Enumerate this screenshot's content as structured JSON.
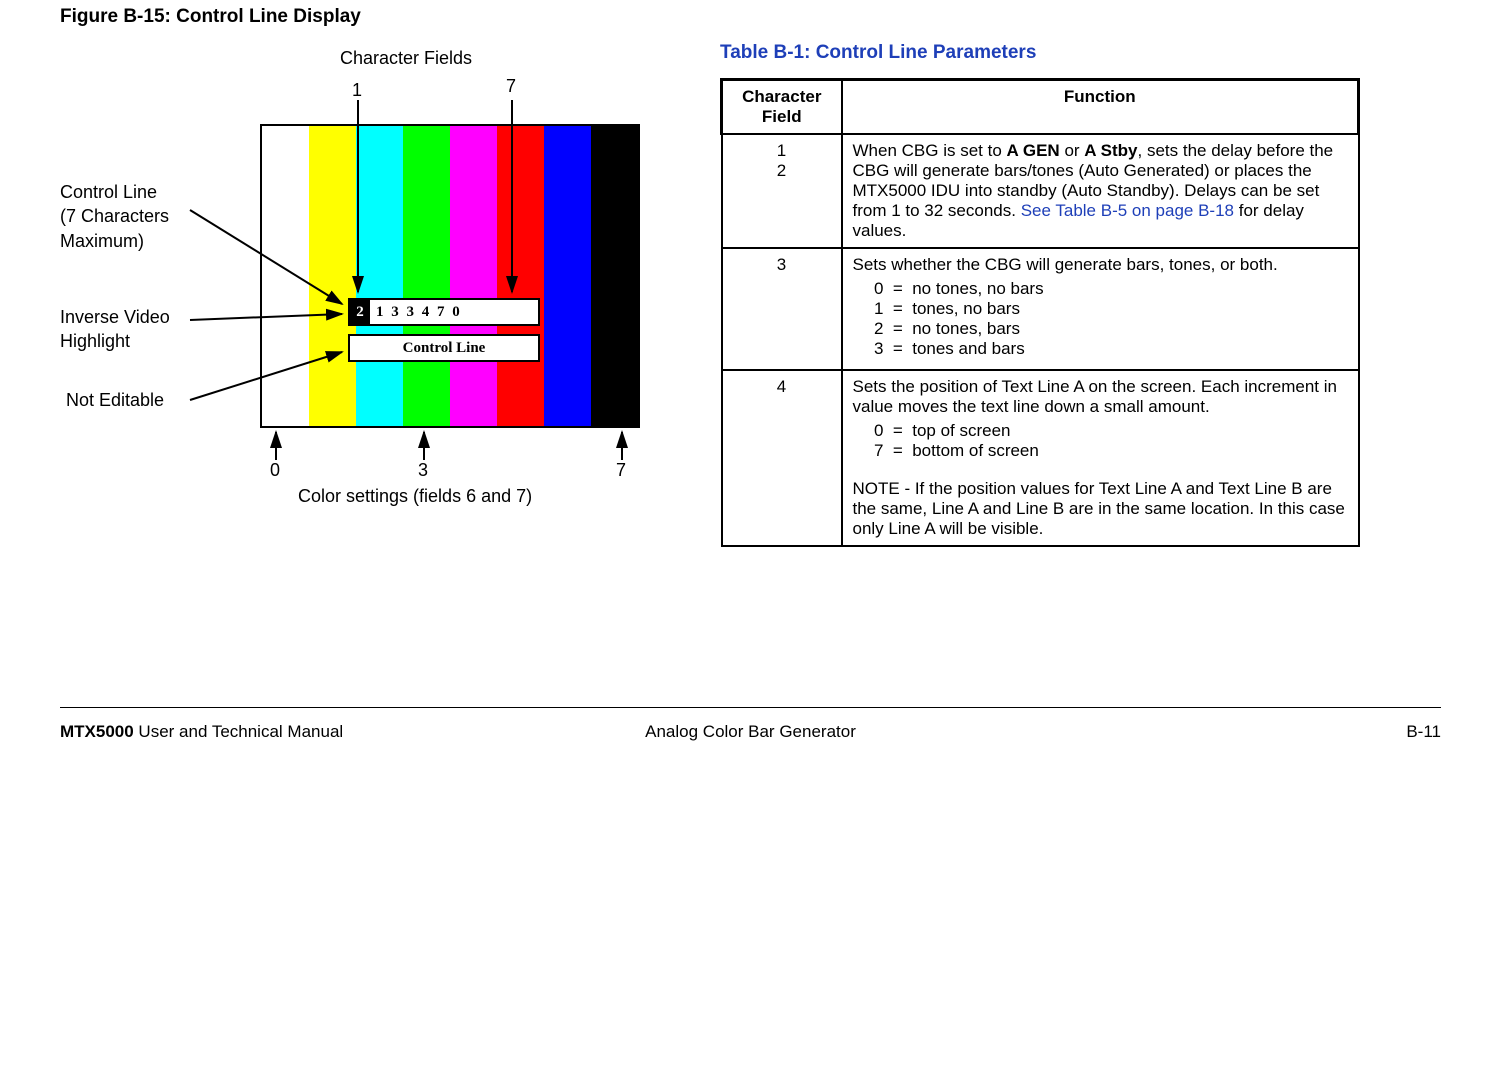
{
  "figure_title": "Figure B-15:   Control Line Display",
  "diagram": {
    "char_fields_label": "Character Fields",
    "top_nums": {
      "one": "1",
      "seven": "7"
    },
    "control_line_label_l1": "Control Line",
    "control_line_label_l2": "(7 Characters",
    "control_line_label_l3": "Maximum)",
    "inverse_video_l1": "Inverse Video",
    "inverse_video_l2": "Highlight",
    "not_editable": "Not Editable",
    "inv_cell": "2",
    "line1_text": "1 3 3 4 7 0",
    "line2_text": "Control Line",
    "bottom_nums": {
      "zero": "0",
      "three": "3",
      "seven": "7"
    },
    "color_settings_label": "Color settings (fields 6 and 7)"
  },
  "table_title": "Table B-1:   Control Line Parameters",
  "table": {
    "headers": {
      "col1": "Character Field",
      "col2": "Function"
    },
    "rows": [
      {
        "field_line1": "1",
        "field_line2": "2",
        "func_pre": "When CBG is set to ",
        "func_bold1": "A GEN",
        "func_mid": " or ",
        "func_bold2": "A Stby",
        "func_post1": ", sets the delay before the CBG will generate bars/tones (Auto Generated) or places the MTX5000 IDU into standby (Auto Standby).  Delays can be set from 1 to 32 seconds.  ",
        "func_link": "See Table B-5 on page B-18",
        "func_post2": " for delay values."
      },
      {
        "field_line1": "3",
        "func_intro": "Sets whether the CBG will generate bars, tones, or both.",
        "opts": [
          "  0  =  no tones, no bars",
          "  1  =  tones, no bars",
          "  2  =  no tones, bars",
          "  3  =  tones and bars"
        ]
      },
      {
        "field_line1": "4",
        "func_intro": "Sets the position of Text Line A on the screen. Each increment in value moves the text line down a small amount.",
        "opts": [
          "  0  =  top of screen",
          "  7  =  bottom of screen"
        ],
        "note": "NOTE - If the position values for Text Line A and Text Line B are the same, Line A and Line B are in the same location. In this case only Line A will be visible."
      }
    ]
  },
  "footer": {
    "left_bold": "MTX5000",
    "left_rest": " User and Technical Manual",
    "center": "Analog Color Bar Generator",
    "right": "B-11"
  }
}
